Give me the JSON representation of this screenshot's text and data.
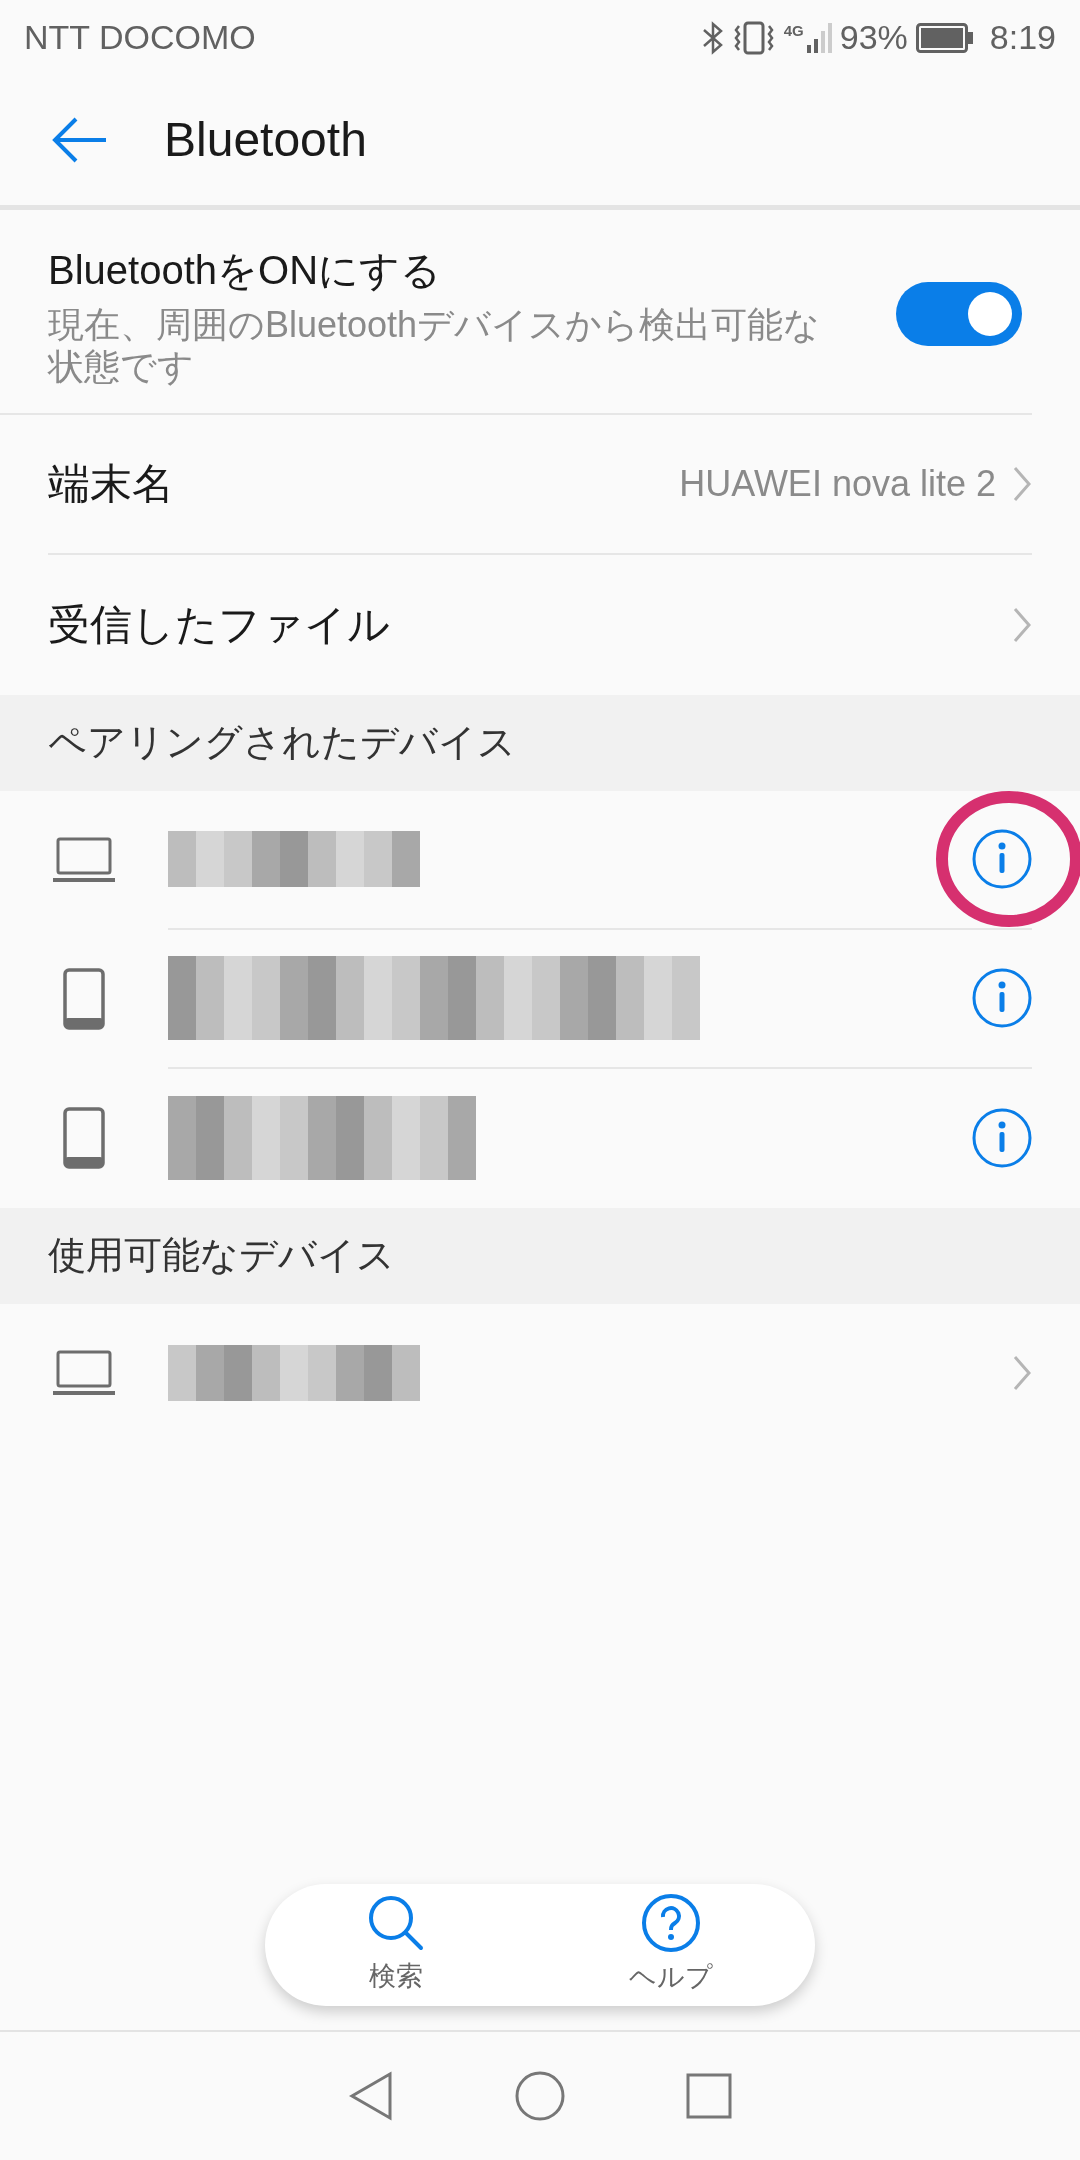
{
  "status_bar": {
    "carrier": "NTT DOCOMO",
    "network": "4G",
    "battery": "93%",
    "time": "8:19"
  },
  "header": {
    "title": "Bluetooth"
  },
  "bluetooth_toggle": {
    "title": "BluetoothをONにする",
    "subtitle": "現在、周囲のBluetoothデバイスから検出可能な状態です",
    "on": true
  },
  "settings": [
    {
      "label": "端末名",
      "value": "HUAWEI nova lite 2"
    },
    {
      "label": "受信したファイル"
    }
  ],
  "sections": [
    {
      "title": "ペアリングされたデバイス",
      "devices": [
        {
          "kind": "laptop",
          "info_button": true,
          "highlighted": true
        },
        {
          "kind": "phone",
          "info_button": true,
          "highlighted": false
        },
        {
          "kind": "phone",
          "info_button": true,
          "highlighted": false
        }
      ]
    },
    {
      "title": "使用可能なデバイス",
      "devices": [
        {
          "kind": "laptop",
          "info_button": false,
          "highlighted": false
        }
      ]
    }
  ],
  "bottom_actions": [
    {
      "kind": "search",
      "label": "検索"
    },
    {
      "kind": "help",
      "label": "ヘルプ"
    }
  ]
}
